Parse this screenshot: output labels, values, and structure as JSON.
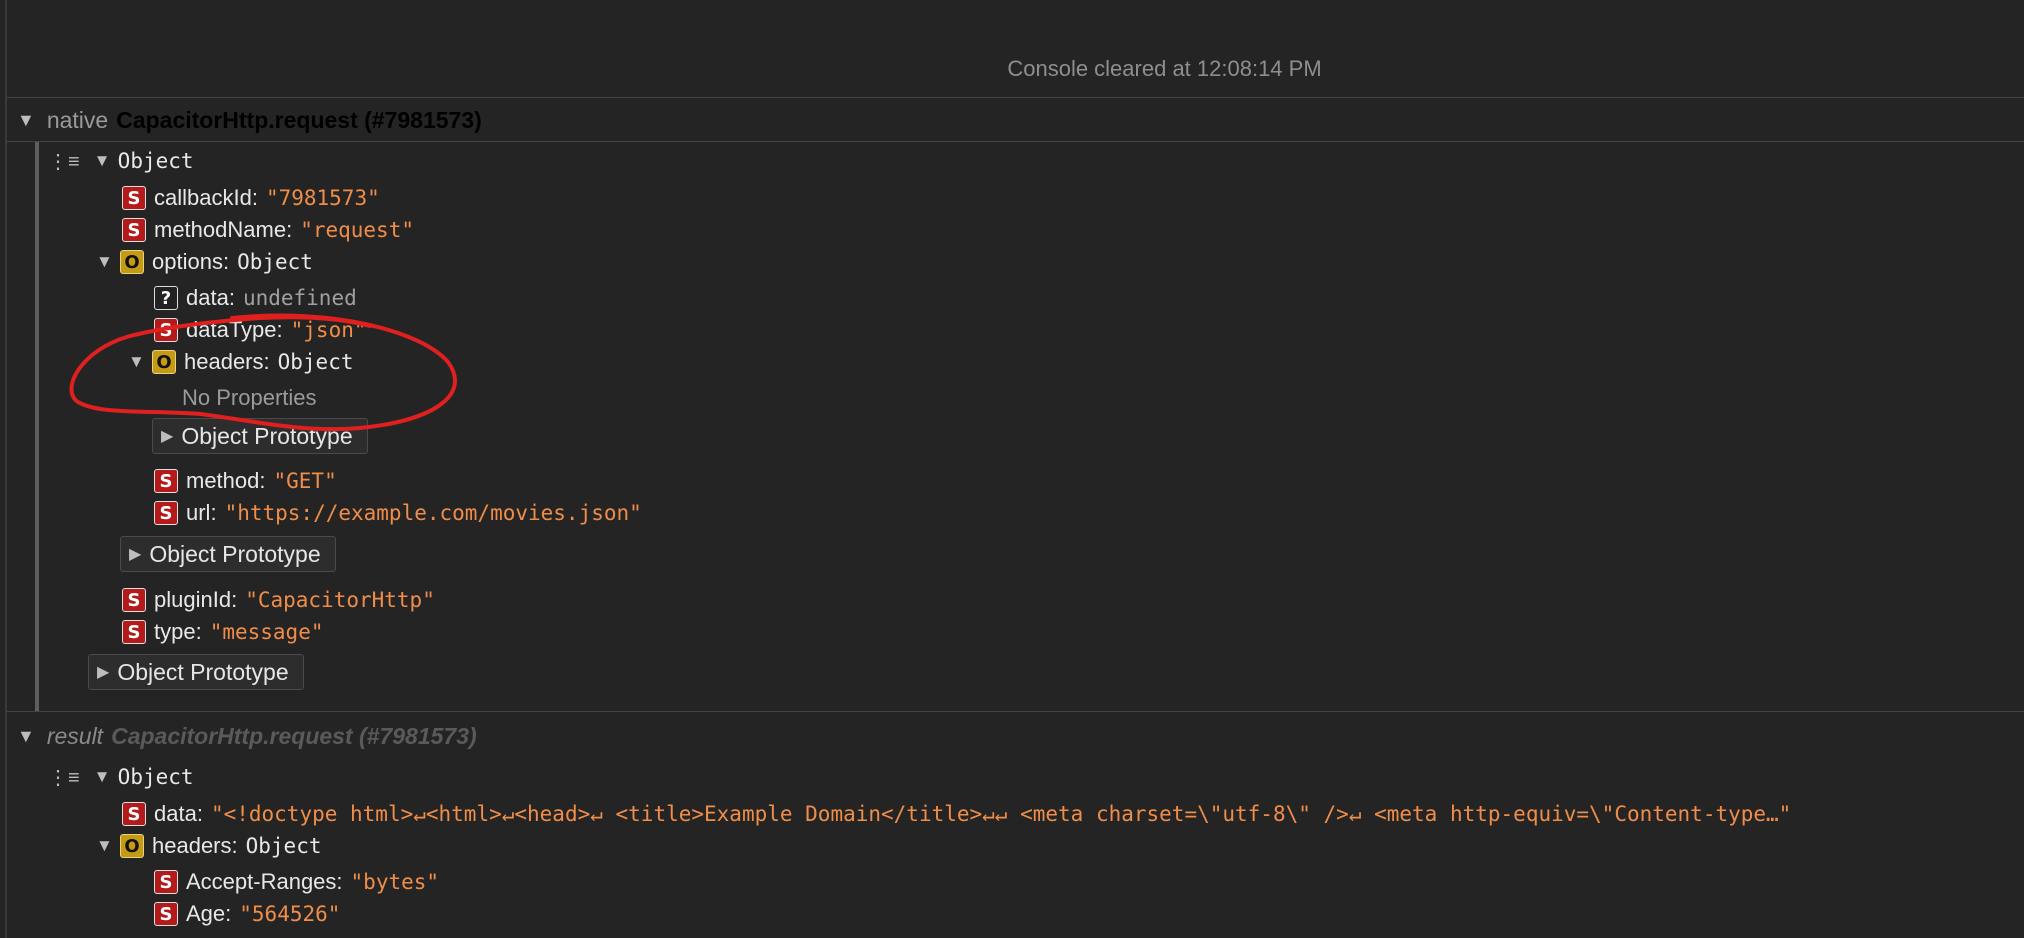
{
  "console": {
    "cleared_text": "Console cleared at 12:08:14 PM"
  },
  "native": {
    "kind": "native",
    "name": "CapacitorHttp.request (#7981573)",
    "object_label": "Object",
    "callbackId": {
      "key": "callbackId:",
      "value": "\"7981573\""
    },
    "methodName": {
      "key": "methodName:",
      "value": "\"request\""
    },
    "options": {
      "key": "options:",
      "value": "Object",
      "data": {
        "key": "data:",
        "value": "undefined"
      },
      "dataType": {
        "key": "dataType:",
        "value": "\"json\""
      },
      "headers": {
        "key": "headers:",
        "value": "Object",
        "empty": "No Properties",
        "proto": "Object Prototype"
      },
      "method": {
        "key": "method:",
        "value": "\"GET\""
      },
      "url": {
        "key": "url:",
        "value": "\"https://example.com/movies.json\""
      },
      "proto": "Object Prototype"
    },
    "pluginId": {
      "key": "pluginId:",
      "value": "\"CapacitorHttp\""
    },
    "type": {
      "key": "type:",
      "value": "\"message\""
    },
    "proto": "Object Prototype"
  },
  "result": {
    "kind": "result",
    "name": "CapacitorHttp.request (#7981573)",
    "object_label": "Object",
    "data": {
      "key": "data:",
      "value": "\"<!doctype html>↵<html>↵<head>↵    <title>Example Domain</title>↵↵    <meta charset=\\\"utf-8\\\" />↵    <meta http-equiv=\\\"Content-type…\""
    },
    "headers": {
      "key": "headers:",
      "value": "Object",
      "accept_ranges": {
        "key": "Accept-Ranges:",
        "value": "\"bytes\""
      },
      "age": {
        "key": "Age:",
        "value": "\"564526\""
      }
    }
  },
  "colors": {
    "string": "#f08d49",
    "badge_string": "#b51a1a",
    "badge_object": "#c59a17",
    "annotation": "#e01f1f"
  },
  "icons": [
    "tree-toggle-icon",
    "disclosure-triangle-icon",
    "string-badge-icon",
    "object-badge-icon",
    "undefined-badge-icon"
  ]
}
